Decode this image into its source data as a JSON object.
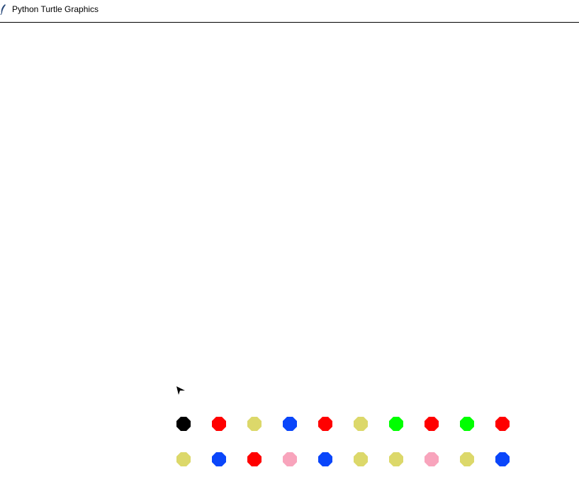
{
  "window": {
    "title": "Python Turtle Graphics",
    "icon": "feather-icon"
  },
  "canvas": {
    "turtle_icon": "turtle-arrow-icon",
    "rows": [
      [
        "#000000",
        "#ff0000",
        "#dcd86a",
        "#0a46fa",
        "#ff0000",
        "#dcd86a",
        "#00ff00",
        "#ff0000",
        "#00ff00",
        "#ff0000"
      ],
      [
        "#dcd86a",
        "#0a46fa",
        "#ff0000",
        "#f8a4bc",
        "#0a46fa",
        "#dcd86a",
        "#dcd86a",
        "#f8a4bc",
        "#dcd86a",
        "#0a46fa"
      ]
    ]
  }
}
